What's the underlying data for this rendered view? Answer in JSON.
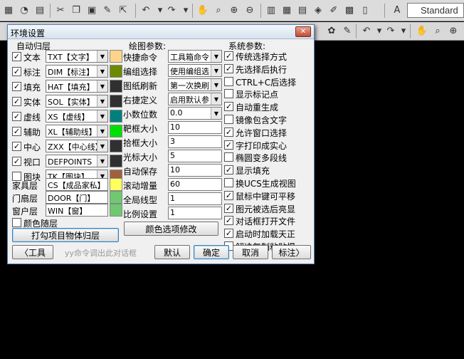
{
  "toolbar": {
    "style_value": "Standard"
  },
  "dialog": {
    "title": "环境设置",
    "auto_layer_title": "自动归层",
    "draw_params_title": "绘图参数:",
    "sys_params_title": "系统参数:",
    "layers": [
      {
        "label": "文本",
        "checked": true,
        "value": "TXT【文字】",
        "color": "#ffd48a"
      },
      {
        "label": "标注",
        "checked": true,
        "value": "DIM【标注】",
        "color": "#6b8a00"
      },
      {
        "label": "填充",
        "checked": true,
        "value": "HAT【填充】",
        "color": "#303030"
      },
      {
        "label": "实体",
        "checked": true,
        "value": "SOL【实体】",
        "color": "#303030"
      },
      {
        "label": "虚线",
        "checked": true,
        "value": "XS【虚线】",
        "color": "#00807a"
      },
      {
        "label": "辅助",
        "checked": true,
        "value": "XL【辅助线】",
        "color": "#00e000"
      },
      {
        "label": "中心",
        "checked": true,
        "value": "ZXX【中心线】",
        "color": "#303030"
      },
      {
        "label": "视口",
        "checked": true,
        "value": "DEFPOINTS【",
        "color": "#303030"
      },
      {
        "label": "图块",
        "checked": false,
        "value": "TK【图块】",
        "color": "#a06040"
      }
    ],
    "text_layers": [
      {
        "label": "家具层",
        "value": "CS【成品家私】",
        "color": "#ffff60"
      },
      {
        "label": "门扇层",
        "value": "DOOR【门】",
        "color": "#70c870"
      },
      {
        "label": "窗户层",
        "value": "WIN【窗】",
        "color": "#70c870"
      }
    ],
    "color_follow_layer": {
      "label": "颜色随层",
      "checked": false
    },
    "apply_button": "打勾项目物体归层",
    "draw_params": [
      {
        "label": "快捷命令",
        "type": "combo",
        "value": "工具箱命令"
      },
      {
        "label": "编组选择",
        "type": "combo",
        "value": "使用编组选"
      },
      {
        "label": "图纸刷新",
        "type": "combo",
        "value": "第一次换刷"
      },
      {
        "label": "右捷定义",
        "type": "combo",
        "value": "启用默认参"
      },
      {
        "label": "小数位数",
        "type": "combo",
        "value": "0.0"
      },
      {
        "label": "靶框大小",
        "type": "input",
        "value": "10"
      },
      {
        "label": "拾框大小",
        "type": "input",
        "value": "3"
      },
      {
        "label": "光标大小",
        "type": "input",
        "value": "5"
      },
      {
        "label": "自动保存",
        "type": "input",
        "value": "10"
      },
      {
        "label": "滚动增量",
        "type": "input",
        "value": "60"
      },
      {
        "label": "全局线型",
        "type": "input",
        "value": "1"
      },
      {
        "label": "比例设置",
        "type": "input",
        "value": "1"
      }
    ],
    "color_options_button": "颜色选项修改",
    "sys_params": [
      {
        "label": "传统选择方式",
        "checked": true
      },
      {
        "label": "先选择后执行",
        "checked": true
      },
      {
        "label": "CTRL+C后选择",
        "checked": false
      },
      {
        "label": "显示标记点",
        "checked": false
      },
      {
        "label": "自动重生成",
        "checked": true
      },
      {
        "label": "镜像包含文字",
        "checked": false
      },
      {
        "label": "允许窗口选择",
        "checked": true
      },
      {
        "label": "字打印成实心",
        "checked": true
      },
      {
        "label": "椭圆变多段线",
        "checked": false
      },
      {
        "label": "显示填充",
        "checked": true
      },
      {
        "label": "换UCS生成视图",
        "checked": false
      },
      {
        "label": "鼠标中键可平移",
        "checked": true
      },
      {
        "label": "图元被选后亮显",
        "checked": true
      },
      {
        "label": "对话框打开文件",
        "checked": true
      },
      {
        "label": "启动时加载天正",
        "checked": true
      },
      {
        "label": "解决复制粘贴慢",
        "checked": false
      }
    ],
    "tools_button": "〈工具",
    "hint_text": "yy命令调出此对话框",
    "default_button": "默认",
    "ok_button": "确定",
    "cancel_button": "取消",
    "annotate_button": "标注〉"
  }
}
